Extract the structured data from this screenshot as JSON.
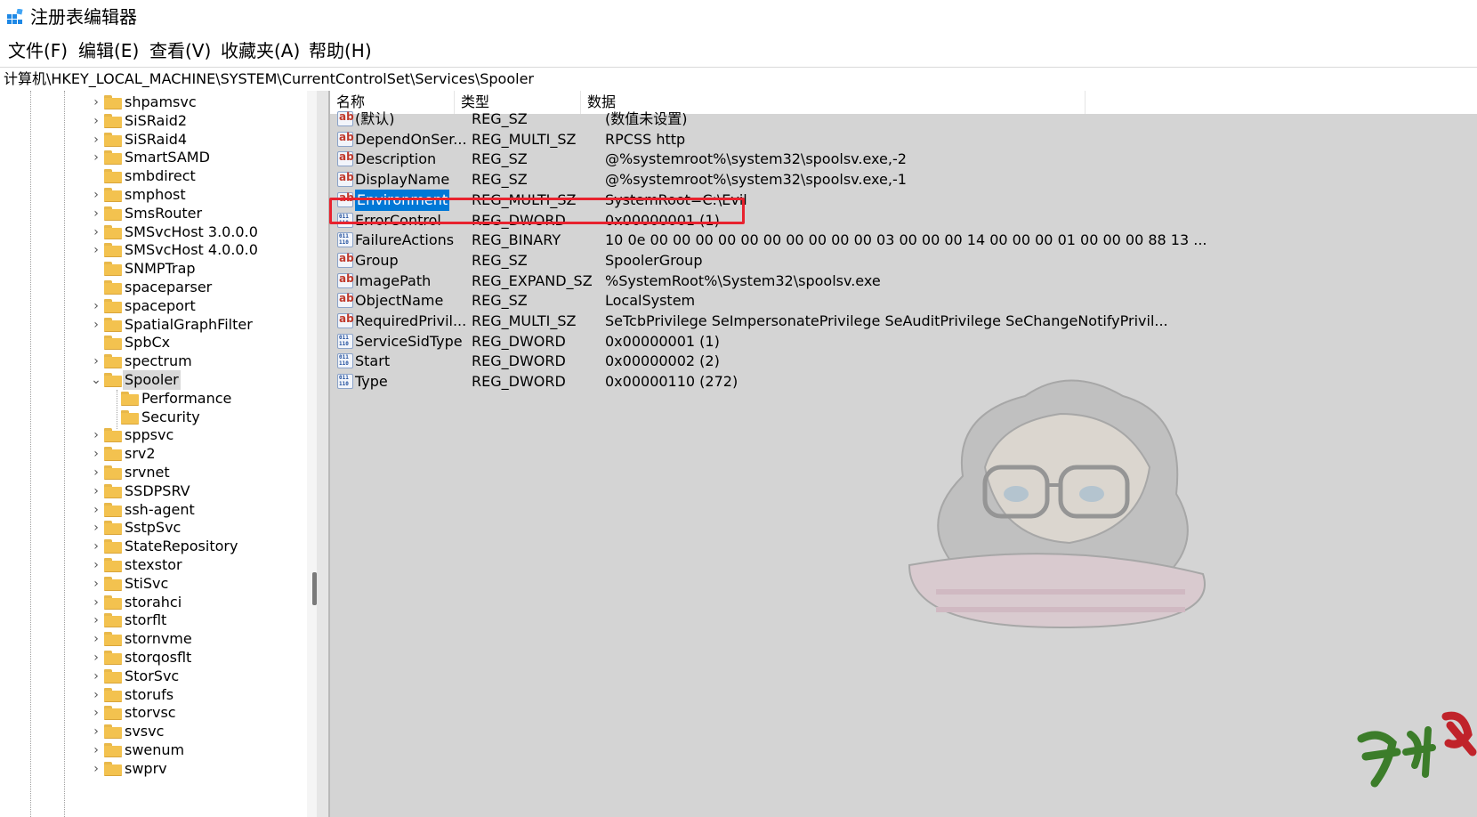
{
  "window": {
    "title": "注册表编辑器"
  },
  "menu": [
    "文件(F)",
    "编辑(E)",
    "查看(V)",
    "收藏夹(A)",
    "帮助(H)"
  ],
  "address": "计算机\\HKEY_LOCAL_MACHINE\\SYSTEM\\CurrentControlSet\\Services\\Spooler",
  "tree": {
    "items": [
      {
        "label": "shpamsvc",
        "expandable": true
      },
      {
        "label": "SiSRaid2",
        "expandable": true
      },
      {
        "label": "SiSRaid4",
        "expandable": true
      },
      {
        "label": "SmartSAMD",
        "expandable": true
      },
      {
        "label": "smbdirect",
        "expandable": false
      },
      {
        "label": "smphost",
        "expandable": true
      },
      {
        "label": "SmsRouter",
        "expandable": true
      },
      {
        "label": "SMSvcHost 3.0.0.0",
        "expandable": true
      },
      {
        "label": "SMSvcHost 4.0.0.0",
        "expandable": true
      },
      {
        "label": "SNMPTrap",
        "expandable": false
      },
      {
        "label": "spaceparser",
        "expandable": false
      },
      {
        "label": "spaceport",
        "expandable": true
      },
      {
        "label": "SpatialGraphFilter",
        "expandable": true
      },
      {
        "label": "SpbCx",
        "expandable": false
      },
      {
        "label": "spectrum",
        "expandable": true
      },
      {
        "label": "Spooler",
        "expandable": true,
        "expanded": true,
        "selected": true
      },
      {
        "label": "Performance",
        "child": true
      },
      {
        "label": "Security",
        "child": true
      },
      {
        "label": "sppsvc",
        "expandable": true
      },
      {
        "label": "srv2",
        "expandable": true
      },
      {
        "label": "srvnet",
        "expandable": true
      },
      {
        "label": "SSDPSRV",
        "expandable": true
      },
      {
        "label": "ssh-agent",
        "expandable": true
      },
      {
        "label": "SstpSvc",
        "expandable": true
      },
      {
        "label": "StateRepository",
        "expandable": true
      },
      {
        "label": "stexstor",
        "expandable": true
      },
      {
        "label": "StiSvc",
        "expandable": true
      },
      {
        "label": "storahci",
        "expandable": true
      },
      {
        "label": "storflt",
        "expandable": true
      },
      {
        "label": "stornvme",
        "expandable": true
      },
      {
        "label": "storqosflt",
        "expandable": true
      },
      {
        "label": "StorSvc",
        "expandable": true
      },
      {
        "label": "storufs",
        "expandable": true
      },
      {
        "label": "storvsc",
        "expandable": true
      },
      {
        "label": "svsvc",
        "expandable": true
      },
      {
        "label": "swenum",
        "expandable": true
      },
      {
        "label": "swprv",
        "expandable": true
      }
    ]
  },
  "columns": {
    "name": "名称",
    "type": "类型",
    "data": "数据"
  },
  "values": [
    {
      "name": "(默认)",
      "type": "REG_SZ",
      "data": "(数值未设置)",
      "icon": "string-value-icon"
    },
    {
      "name": "DependOnSer...",
      "type": "REG_MULTI_SZ",
      "data": "RPCSS http",
      "icon": "string-value-icon"
    },
    {
      "name": "Description",
      "type": "REG_SZ",
      "data": "@%systemroot%\\system32\\spoolsv.exe,-2",
      "icon": "string-value-icon"
    },
    {
      "name": "DisplayName",
      "type": "REG_SZ",
      "data": "@%systemroot%\\system32\\spoolsv.exe,-1",
      "icon": "string-value-icon"
    },
    {
      "name": "Environment",
      "type": "REG_MULTI_SZ",
      "data": "SystemRoot=C:\\Evil",
      "icon": "string-value-icon",
      "selected": true
    },
    {
      "name": "ErrorControl",
      "type": "REG_DWORD",
      "data": "0x00000001 (1)",
      "icon": "binary-value-icon"
    },
    {
      "name": "FailureActions",
      "type": "REG_BINARY",
      "data": "10 0e 00 00 00 00 00 00 00 00 00 00 03 00 00 00 14 00 00 00 01 00 00 00 88 13 ...",
      "icon": "binary-value-icon"
    },
    {
      "name": "Group",
      "type": "REG_SZ",
      "data": "SpoolerGroup",
      "icon": "string-value-icon"
    },
    {
      "name": "ImagePath",
      "type": "REG_EXPAND_SZ",
      "data": "%SystemRoot%\\System32\\spoolsv.exe",
      "icon": "string-value-icon"
    },
    {
      "name": "ObjectName",
      "type": "REG_SZ",
      "data": "LocalSystem",
      "icon": "string-value-icon"
    },
    {
      "name": "RequiredPrivil...",
      "type": "REG_MULTI_SZ",
      "data": "SeTcbPrivilege SeImpersonatePrivilege SeAuditPrivilege SeChangeNotifyPrivil...",
      "icon": "string-value-icon"
    },
    {
      "name": "ServiceSidType",
      "type": "REG_DWORD",
      "data": "0x00000001 (1)",
      "icon": "binary-value-icon"
    },
    {
      "name": "Start",
      "type": "REG_DWORD",
      "data": "0x00000002 (2)",
      "icon": "binary-value-icon"
    },
    {
      "name": "Type",
      "type": "REG_DWORD",
      "data": "0x00000110 (272)",
      "icon": "binary-value-icon"
    }
  ],
  "annotation": {
    "color": "#e8222e"
  },
  "colors": {
    "selection": "#0078d7",
    "list_background": "#d4d4d4",
    "folder": "#f3c24f"
  }
}
